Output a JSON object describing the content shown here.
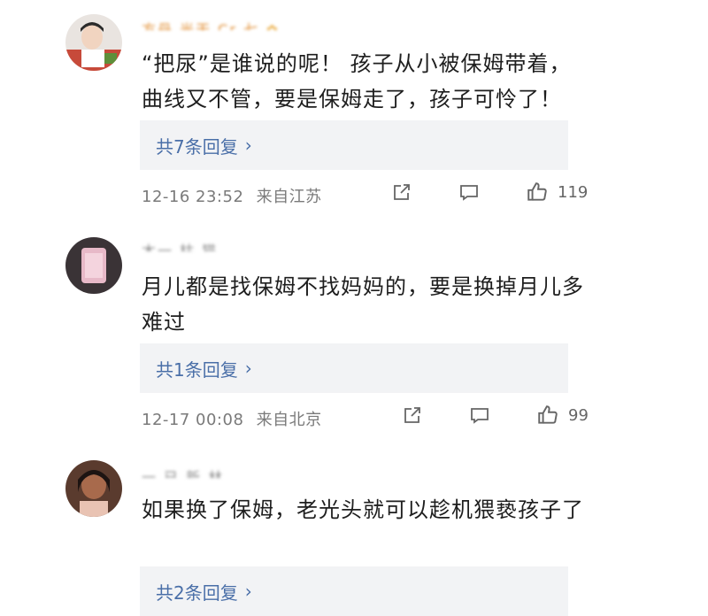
{
  "comments": [
    {
      "username": "方丹 光天 Cr 七",
      "text": "“把尿”是谁说的呢！ 孩子从小被保姆带着，曲线又不管，要是保姆走了，孩子可怜了！",
      "replies_label": "共7条回复",
      "time": "12-16 23:52",
      "location": "来自江苏",
      "likes": "119"
    },
    {
      "username": "木一 枯 猫",
      "text": "月儿都是找保姆不找妈妈的，要是换掉月儿多难过",
      "replies_label": "共1条回复",
      "time": "12-17 00:08",
      "location": "来自北京",
      "likes": "99"
    },
    {
      "username": "一 已 新 林",
      "text": "如果换了保姆，老光头就可以趁机猥亵孩子了",
      "replies_label": "共2条回复"
    }
  ],
  "icons": {
    "share": "share-icon",
    "comment": "comment-icon",
    "like": "like-icon",
    "chevron": "chevron-right-icon"
  },
  "colors": {
    "reply_link": "#4a6fa8",
    "meta": "#7a7a7a",
    "reply_bg": "#f2f3f5",
    "username_vip": "#e08a2c"
  }
}
